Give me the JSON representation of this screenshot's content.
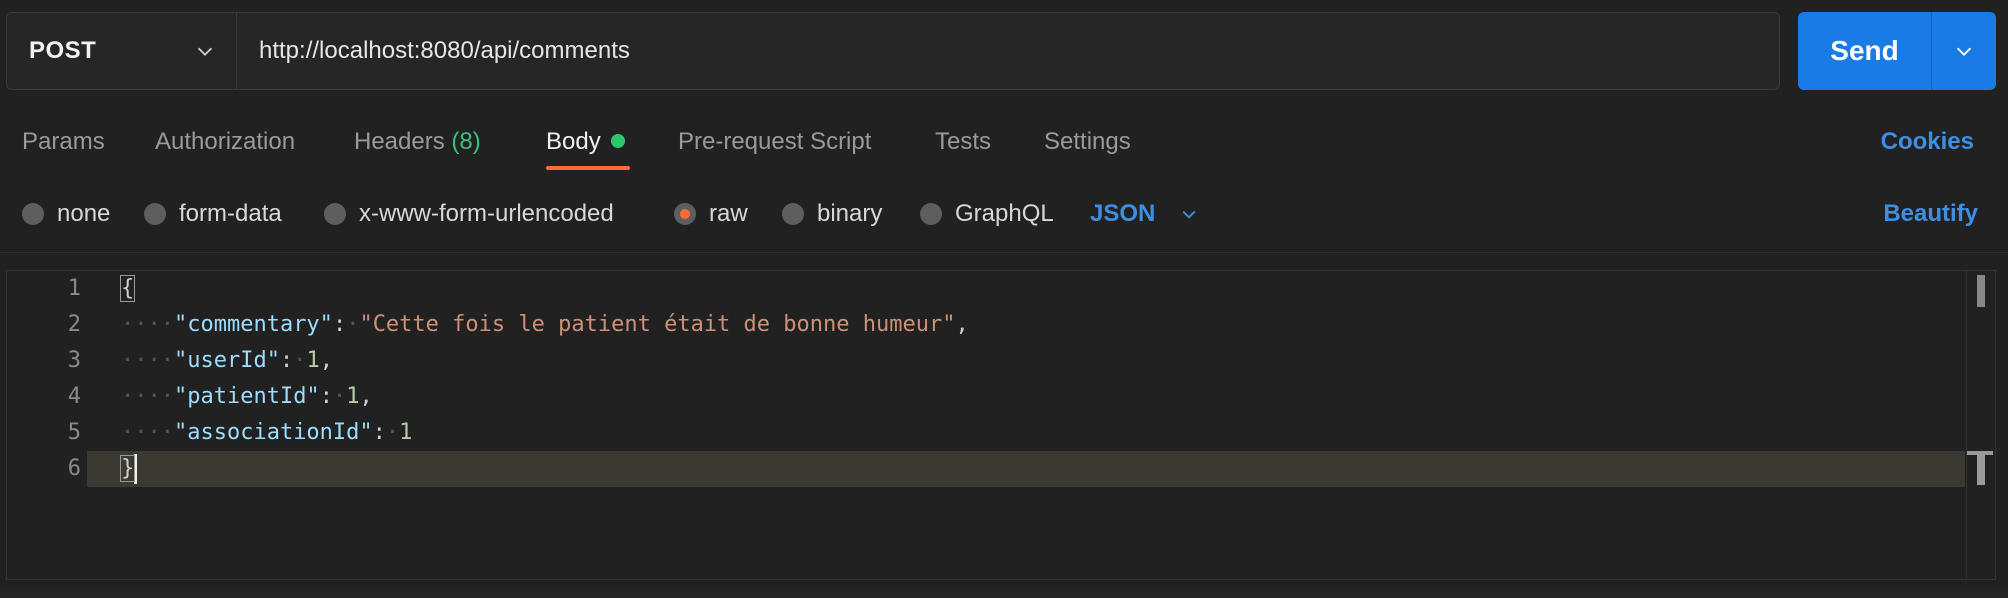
{
  "request": {
    "method": "POST",
    "url": "http://localhost:8080/api/comments",
    "send_label": "Send"
  },
  "tabs": [
    {
      "label": "Params"
    },
    {
      "label": "Authorization"
    },
    {
      "label": "Headers",
      "count": "(8)"
    },
    {
      "label": "Body"
    },
    {
      "label": "Pre-request Script"
    },
    {
      "label": "Tests"
    },
    {
      "label": "Settings"
    }
  ],
  "cookies_label": "Cookies",
  "body_types": [
    {
      "label": "none"
    },
    {
      "label": "form-data"
    },
    {
      "label": "x-www-form-urlencoded"
    },
    {
      "label": "raw"
    },
    {
      "label": "binary"
    },
    {
      "label": "GraphQL"
    }
  ],
  "selected_body_type": "raw",
  "language": "JSON",
  "beautify_label": "Beautify",
  "editor": {
    "line_numbers": [
      "1",
      "2",
      "3",
      "4",
      "5",
      "6"
    ],
    "json": {
      "commentary": "Cette fois le patient était de bonne humeur",
      "userId": "1",
      "patientId": "1",
      "associationId": "1"
    },
    "keys": {
      "commentary": "\"commentary\"",
      "userId": "\"userId\"",
      "patientId": "\"patientId\"",
      "associationId": "\"associationId\""
    },
    "open_brace": "{",
    "close_brace": "}"
  },
  "colors": {
    "accent_blue": "#1b7be6",
    "active_tab_underline": "#ff6c37",
    "headers_count": "#3fbf7f",
    "body_dot": "#2ec56f"
  }
}
